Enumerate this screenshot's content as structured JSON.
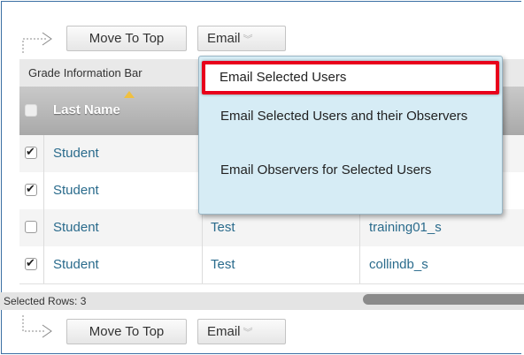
{
  "toolbar_top": {
    "move_to_top": "Move To Top",
    "email": "Email"
  },
  "toolbar_bottom": {
    "move_to_top": "Move To Top",
    "email": "Email"
  },
  "grade_info_bar": "Grade Information Bar",
  "table": {
    "header": {
      "last_name": "Last Name"
    },
    "rows": [
      {
        "checked": true,
        "last_name": "Student",
        "first_name": "",
        "username": ""
      },
      {
        "checked": true,
        "last_name": "Student",
        "first_name": "",
        "username": ""
      },
      {
        "checked": false,
        "last_name": "Student",
        "first_name": "Test",
        "username": "training01_s"
      },
      {
        "checked": true,
        "last_name": "Student",
        "first_name": "Test",
        "username": "collindb_s"
      }
    ]
  },
  "selected_rows": "Selected Rows: 3",
  "email_menu": {
    "items": [
      "Email Selected Users",
      "Email Selected Users and their Observers",
      "Email Observers for Selected Users"
    ]
  },
  "colors": {
    "highlight": "#e8001b",
    "menu_bg": "#d6ecf5",
    "link": "#2a6b8c"
  }
}
